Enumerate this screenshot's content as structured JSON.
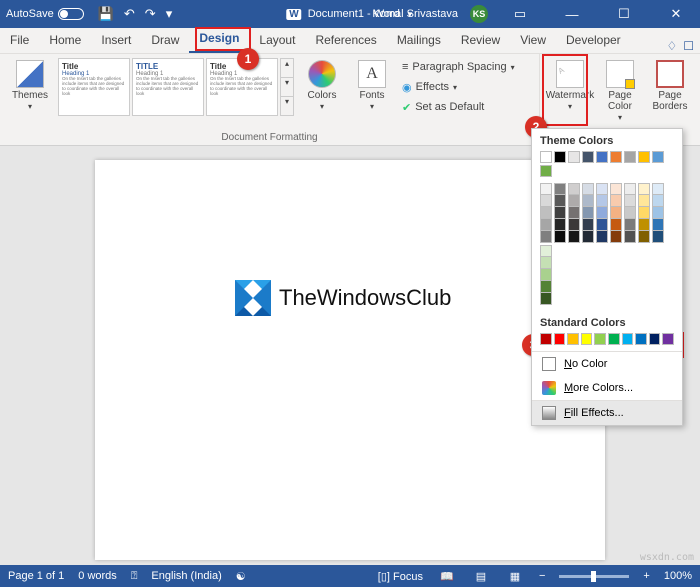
{
  "titlebar": {
    "autosave_label": "AutoSave",
    "doc_name": "Document1 - Word",
    "user_name": "Komal Srivastava",
    "user_initials": "KS"
  },
  "tabs": [
    "File",
    "Home",
    "Insert",
    "Draw",
    "Design",
    "Layout",
    "References",
    "Mailings",
    "Review",
    "View",
    "Developer"
  ],
  "active_tab_index": 4,
  "ribbon": {
    "themes_label": "Themes",
    "gallery_title1": "Title",
    "gallery_heading": "Heading 1",
    "gallery_title2": "TITLE",
    "colors_label": "Colors",
    "fonts_label": "Fonts",
    "para_spacing": "Paragraph Spacing",
    "effects": "Effects",
    "set_default": "Set as Default",
    "grp_docfmt": "Document Formatting",
    "watermark_label": "Watermark",
    "page_color_label": "Page Color",
    "page_borders_label": "Page Borders"
  },
  "dropdown": {
    "theme_hdr": "Theme Colors",
    "std_hdr": "Standard Colors",
    "no_color": "No Color",
    "more_colors": "More Colors...",
    "fill_effects": "Fill Effects...",
    "theme_top": [
      "#ffffff",
      "#000000",
      "#e7e6e6",
      "#44546a",
      "#4472c4",
      "#ed7d31",
      "#a5a5a5",
      "#ffc000",
      "#5b9bd5",
      "#70ad47"
    ],
    "theme_shades": [
      [
        "#f2f2f2",
        "#808080",
        "#d0cece",
        "#d6dce5",
        "#d9e2f3",
        "#fbe5d6",
        "#ededed",
        "#fff2cc",
        "#deebf7",
        "#e2f0d9"
      ],
      [
        "#d9d9d9",
        "#595959",
        "#aeabab",
        "#adb9ca",
        "#b4c7e7",
        "#f8cbad",
        "#dbdbdb",
        "#ffe699",
        "#bdd7ee",
        "#c5e0b4"
      ],
      [
        "#bfbfbf",
        "#404040",
        "#757171",
        "#8497b0",
        "#8faadc",
        "#f4b183",
        "#c9c9c9",
        "#ffd966",
        "#9dc3e6",
        "#a9d18e"
      ],
      [
        "#a6a6a6",
        "#262626",
        "#3b3838",
        "#333f50",
        "#2f5597",
        "#c55a11",
        "#7b7b7b",
        "#bf9000",
        "#2e75b6",
        "#548235"
      ],
      [
        "#7f7f7f",
        "#0d0d0d",
        "#171717",
        "#222a35",
        "#1f3864",
        "#843c0c",
        "#525252",
        "#806000",
        "#1f4e79",
        "#385723"
      ]
    ],
    "standard": [
      "#c00000",
      "#ff0000",
      "#ffc000",
      "#ffff00",
      "#92d050",
      "#00b050",
      "#00b0f0",
      "#0070c0",
      "#002060",
      "#7030a0"
    ]
  },
  "page": {
    "brand_text": "TheWindowsClub"
  },
  "status": {
    "page": "Page 1 of 1",
    "words": "0 words",
    "lang": "English (India)",
    "focus": "Focus",
    "zoom": "100%"
  },
  "watermark": "wsxdn.com"
}
